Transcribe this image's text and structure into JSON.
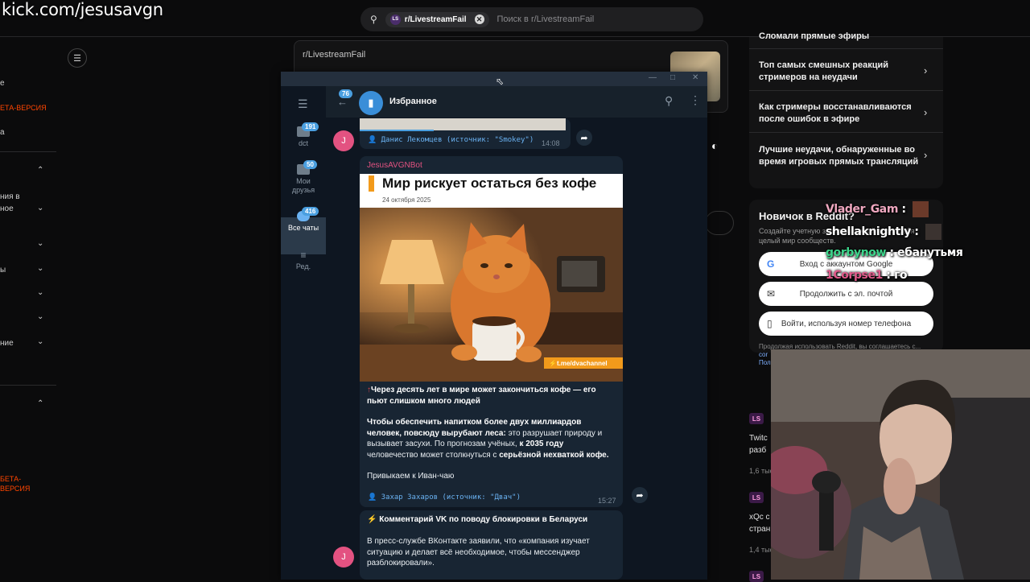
{
  "overlay": {
    "url": "kick.com/jesusavgn"
  },
  "reddit": {
    "search": {
      "chip": "r/LivestreamFail",
      "placeholder": "Поиск в r/LivestreamFail"
    },
    "left_sidebar": {
      "items": [
        "е",
        "ЕТА-ВЕРСИЯ",
        "а",
        "ния в",
        "ное",
        "ы",
        "ние"
      ],
      "beta": [
        "БЕТА-",
        "ВЕРСИЯ"
      ]
    },
    "post": {
      "subreddit": "r/LivestreamFail"
    },
    "related": [
      "Сломали прямые эфиры",
      "Топ самых смешных реакций стримеров на неудачи",
      "Как стримеры восстанавливаются после ошибок в эфире",
      "Лучшие неудачи, обнаруженные во время игровых прямых трансляций"
    ],
    "signup": {
      "title": "Новичок в Reddit?",
      "desc": "Создайте учетную запись и откройте для себя целый мир сообществ.",
      "google": "Вход с аккаунтом Google",
      "email": "Продолжить с эл. почтой",
      "phone": "Войти, используя номер телефона",
      "terms": "Продолжая использовать Reddit, вы соглашаетесь с...",
      "terms_link1": "cor",
      "terms_link2": "Пол"
    },
    "feed": [
      {
        "badge": "LS",
        "text1": "Twitc",
        "text2": "разб",
        "meta": "1,6 тыс"
      },
      {
        "badge": "LS",
        "text1": "xQc c",
        "text2": "стран",
        "meta": "1,4 тыс"
      },
      {
        "badge": "LS"
      }
    ]
  },
  "chat_overlay": [
    {
      "user": "Vlader_Gam",
      "msg": "",
      "color": "#f0a8c0"
    },
    {
      "user": "shellaknightly",
      "msg": "",
      "color": "#ffffff"
    },
    {
      "user": "gorbynow",
      "msg": "ебанутьмя",
      "color": "#3dd68c"
    },
    {
      "user": "1Corpse1",
      "msg": "го",
      "color": "#e05a8a"
    }
  ],
  "telegram": {
    "rail": [
      {
        "label": "dct",
        "badge": "191"
      },
      {
        "label": "Мои друзья",
        "badge": "50"
      },
      {
        "label": "Все чаты",
        "badge": "416"
      },
      {
        "label": "Ред."
      }
    ],
    "back_badge": "76",
    "header_title": "Избранное",
    "messages": {
      "first_sig": "Данис Лекомцев (источник: \"Smokey\")",
      "first_time": "14:08",
      "sender": "JesusAVGNBot",
      "card_title": "Мир рискует остаться без кофе",
      "card_date": "24 октября 2025",
      "card_tag": "t.me/dvachannel",
      "p1": "Через десять лет в мире может закончиться кофе — его пьют слишком много людей",
      "p2_bold": "Чтобы обеспечить напитком более двух миллиардов человек, повсюду вырубают леса:",
      "p2_rest": " это разрушает природу и вызывает засухи. По прогнозам учёных, ",
      "p2_bold2": "к 2035 году",
      "p2_rest2": " человечество может столкнуться с ",
      "p2_bold3": "серьёзной нехваткой кофе.",
      "p3": "Привыкаем к Иван-чаю",
      "second_sig": "Захар Захаров (источник: \"Двач\")",
      "second_time": "15:27",
      "third_title": "Комментарий VK по поводу блокировки в Беларуси",
      "third_text": "В пресс-службе ВКонтакте заявили, что «компания изучает ситуацию и делает всё необходимое, чтобы мессенджер разблокировали».",
      "avatar_letter": "J"
    }
  },
  "colors": {
    "reddit_orange": "#ff4500",
    "tg_accent": "#4a9fe0",
    "tg_bg": "#0e1621"
  }
}
